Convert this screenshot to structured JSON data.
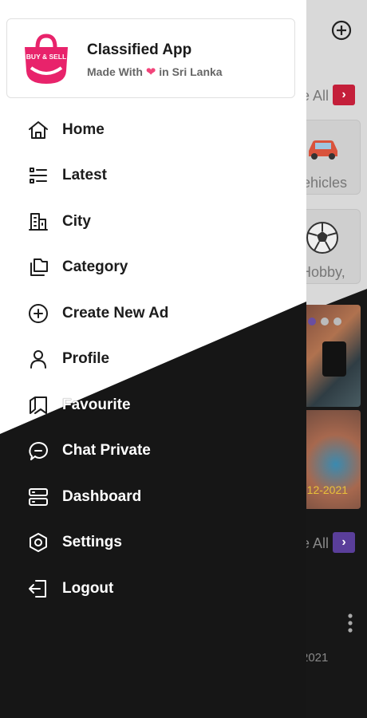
{
  "header": {
    "app_name": "Classified App",
    "tagline_prefix": "Made With",
    "tagline_suffix": "in Sri Lanka",
    "logo_text": "BUY & SELL"
  },
  "menu": [
    {
      "label": "Home",
      "icon": "home-icon"
    },
    {
      "label": "Latest",
      "icon": "list-icon"
    },
    {
      "label": "City",
      "icon": "city-icon"
    },
    {
      "label": "Category",
      "icon": "category-icon"
    },
    {
      "label": "Create New Ad",
      "icon": "add-circle-icon"
    },
    {
      "label": "Profile",
      "icon": "profile-icon"
    },
    {
      "label": "Favourite",
      "icon": "favourite-icon"
    },
    {
      "label": "Chat Private",
      "icon": "chat-icon"
    },
    {
      "label": "Dashboard",
      "icon": "dashboard-icon"
    },
    {
      "label": "Settings",
      "icon": "settings-icon"
    },
    {
      "label": "Logout",
      "icon": "logout-icon"
    }
  ],
  "background": {
    "view_all_1": "e All",
    "view_all_2": "e All",
    "card_vehicles": "ehicles",
    "card_hobby": "Hobby,",
    "date_1": "-12-2021",
    "date_2": "2021"
  },
  "colors": {
    "brand_pink": "#e8236b",
    "view_all_chevron_1": "#c41f3a",
    "view_all_chevron_2": "#5a3e9a",
    "dark_bg": "#161616"
  }
}
